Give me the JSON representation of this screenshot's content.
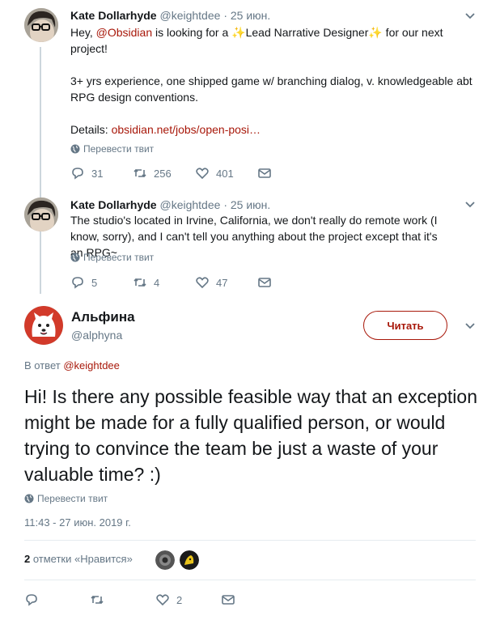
{
  "tweets": [
    {
      "name": "Kate Dollarhyde",
      "handle": "@keightdee",
      "separator": "·",
      "date": "25 июн.",
      "text_parts": {
        "a": "Hey, ",
        "mention": "@Obsidian",
        "b": " is looking for a ",
        "sparkle1": "✨",
        "role": "Lead Narrative Designer",
        "sparkle2": "✨",
        "c": " for our next project!",
        "p2": "3+ yrs experience, one shipped game w/ branching dialog, v. knowledgeable abt RPG design conventions.",
        "details_label": "Details: ",
        "details_link": "obsidian.net/jobs/open-posi…"
      },
      "translate": "Перевести твит",
      "replies": "31",
      "retweets": "256",
      "likes": "401"
    },
    {
      "name": "Kate Dollarhyde",
      "handle": "@keightdee",
      "separator": "·",
      "date": "25 июн.",
      "text": "The studio's located in Irvine, California, we don't really do remote work (I know, sorry), and I can't tell you anything about the project except that it's an RPG~",
      "translate": "Перевести твит",
      "replies": "5",
      "retweets": "4",
      "likes": "47"
    }
  ],
  "main": {
    "name": "Альфина",
    "handle": "@alphyna",
    "follow_label": "Читать",
    "reply_prefix": "В ответ ",
    "reply_handle": "@keightdee",
    "text": "Hi! Is there any possible feasible way that an exception might be made for a fully qualified person, or would trying to convince the team be just a waste of your valuable time? :)",
    "translate": "Перевести твит",
    "timestamp": "11:43 - 27 июн. 2019 г.",
    "likes_count": "2",
    "likes_label": " отметки «Нравится»",
    "likes_action": "2"
  },
  "colors": {
    "link": "#a8180a",
    "muted": "#657786",
    "text": "#14171a",
    "line": "#ccd6dd"
  }
}
